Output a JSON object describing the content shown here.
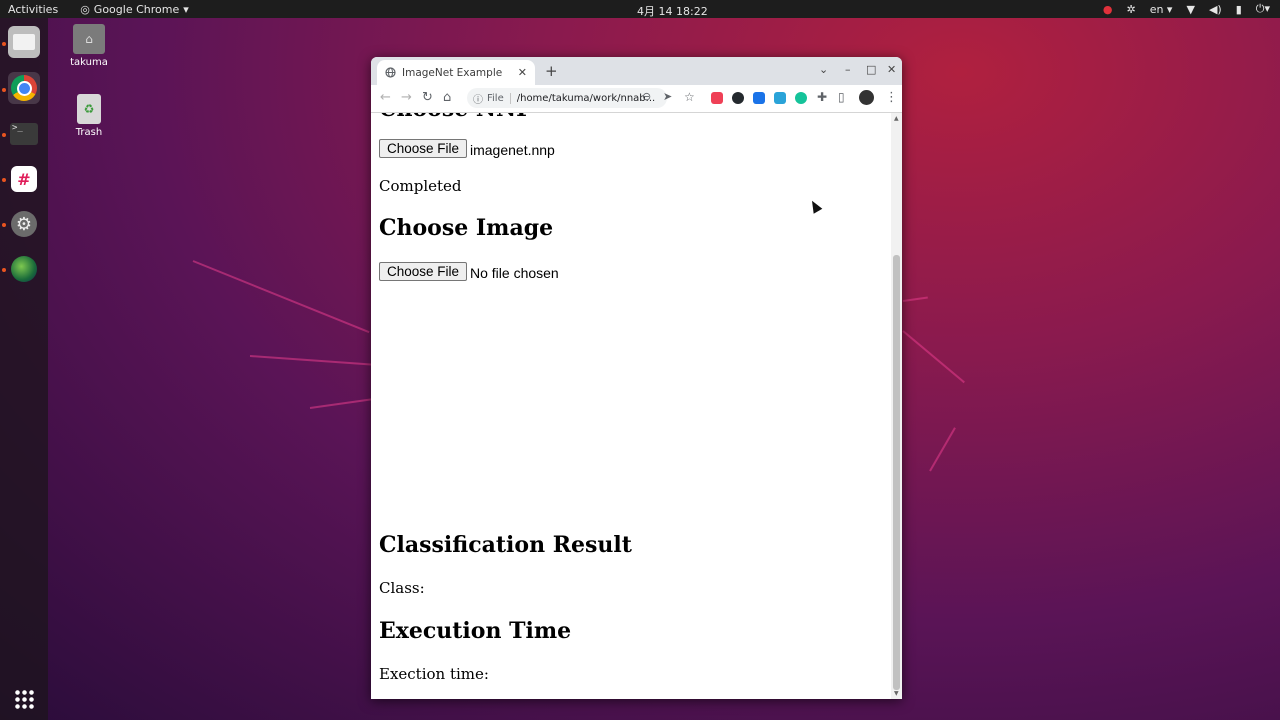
{
  "topbar": {
    "activities": "Activities",
    "app_name": "Google Chrome",
    "clock": "4月 14 18:22",
    "lang": "en"
  },
  "desktop": {
    "home_label": "takuma",
    "trash_label": "Trash"
  },
  "browser": {
    "tab_title": "ImageNet Example",
    "url_scheme": "File",
    "url": "/home/takuma/work/nnab..."
  },
  "page": {
    "heading_nnp": "Choose NNP",
    "file_button_1": "Choose File",
    "file_name_1": "imagenet.nnp",
    "status": "Completed",
    "heading_image": "Choose Image",
    "file_button_2": "Choose File",
    "file_name_2": "No file chosen",
    "heading_result": "Classification Result",
    "class_label": "Class:",
    "heading_time": "Execution Time",
    "time_label": "Exection time:"
  },
  "colors": {
    "ubuntu_accent": "#e95420"
  }
}
